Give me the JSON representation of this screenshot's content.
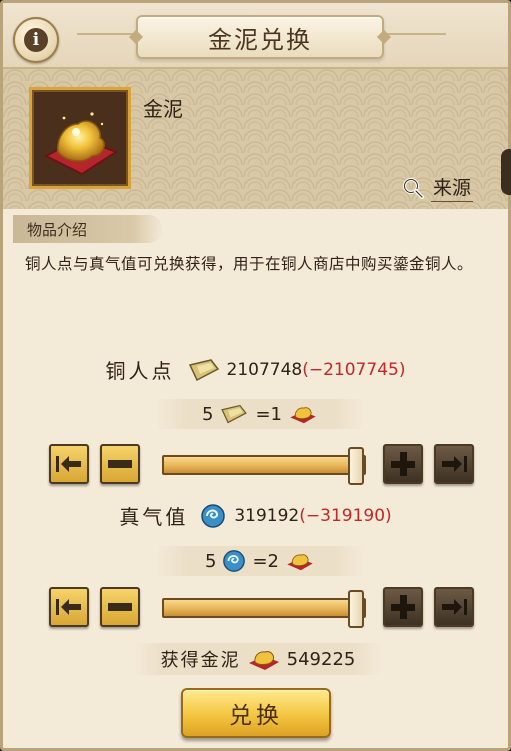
{
  "header": {
    "title": "金泥兑换",
    "info_symbol": "i"
  },
  "item": {
    "name": "金泥",
    "source_label": "来源"
  },
  "description": {
    "tab_label": "物品介绍",
    "text": "铜人点与真气值可兑换获得，用于在铜人商店中购买鎏金铜人。"
  },
  "exchange_1": {
    "label": "铜人点",
    "amount": "2107748",
    "change": "(−2107745)",
    "rate_cost": "5",
    "rate_result": "=1",
    "slider_fraction": 1.0
  },
  "exchange_2": {
    "label": "真气值",
    "amount": "319192",
    "change": "(−319190)",
    "rate_cost": "5",
    "rate_result": "=2",
    "slider_fraction": 1.0
  },
  "obtain": {
    "label": "获得金泥",
    "amount": "549225"
  },
  "action": {
    "exchange_label": "兑换"
  },
  "colors": {
    "accent_gold": "#e7b55a",
    "negative": "#c0282a",
    "parchment": "#f4ead8"
  }
}
